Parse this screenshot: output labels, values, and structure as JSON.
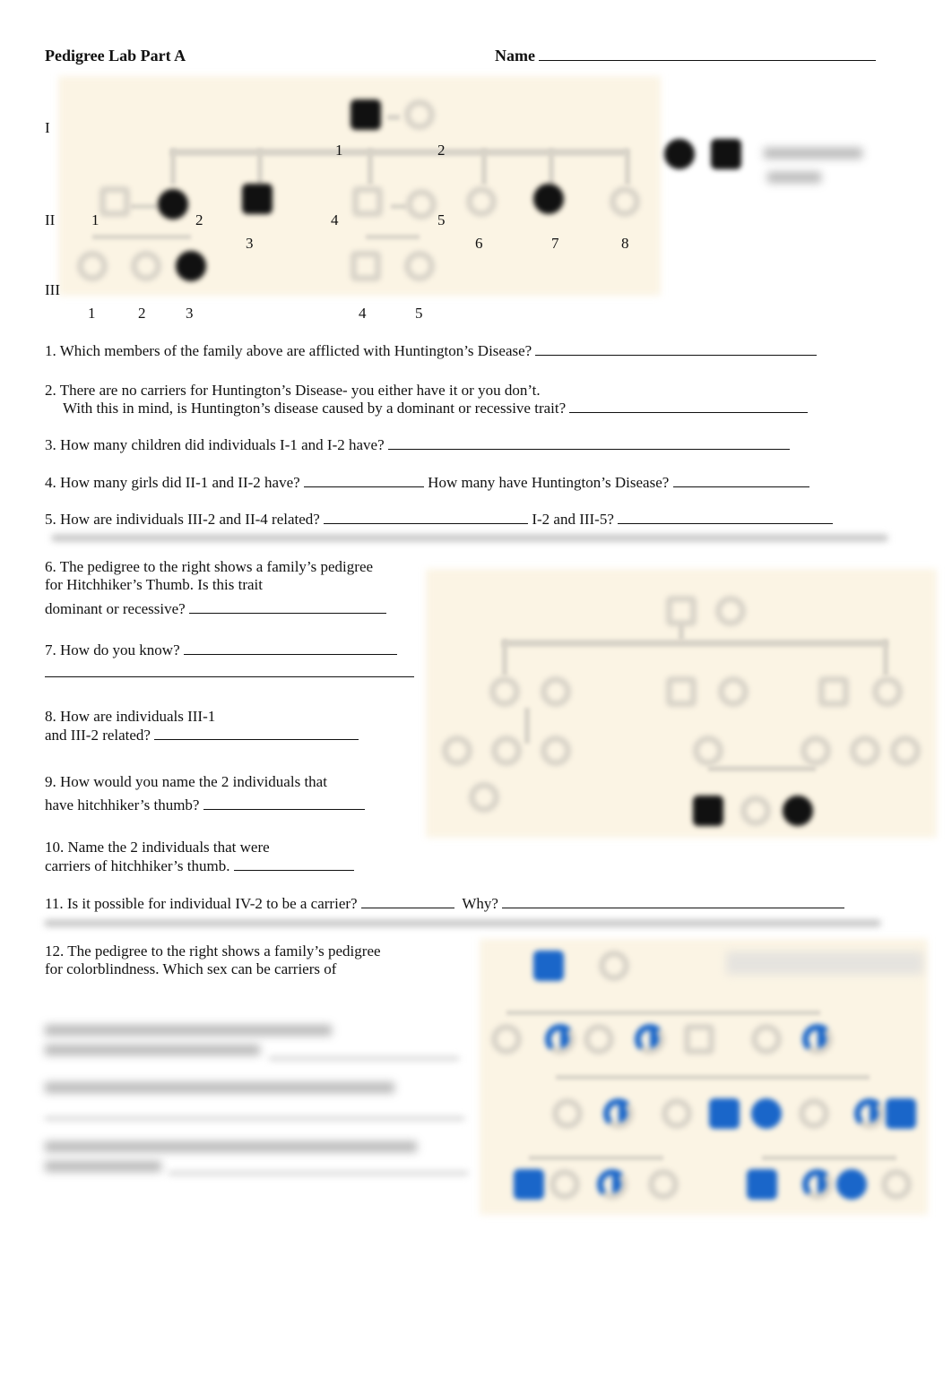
{
  "header": {
    "title": "Pedigree Lab Part A",
    "name_label": "Name"
  },
  "pedigree1": {
    "generations": [
      "I",
      "II",
      "III"
    ],
    "gen1_numbers": [
      "1",
      "2"
    ],
    "gen2_numbers": [
      "1",
      "2",
      "3",
      "4",
      "5",
      "6",
      "7",
      "8"
    ],
    "gen3_numbers": [
      "1",
      "2",
      "3",
      "4",
      "5"
    ],
    "trait_color": "#111111"
  },
  "pedigree3": {
    "trait_color": "#1a66c9"
  },
  "questions": {
    "q1": "1. Which members of the family above are afflicted with Huntington’s Disease?",
    "q2a": "2. There are no carriers for Huntington’s Disease- you either have it or you don’t.",
    "q2b": "With this in mind, is Huntington’s disease caused by a dominant or recessive trait?",
    "q3": "3. How many children did individuals I-1 and I-2 have?",
    "q4a": "4. How many girls did II-1 and II-2 have?",
    "q4b": "How many have Huntington’s Disease?",
    "q5a": "5. How are individuals III-2 and II-4 related?",
    "q5b": "I-2 and III-5?",
    "q6a": "6. The pedigree to the right shows a family’s pedigree",
    "q6b": "for Hitchhiker’s Thumb.  Is this trait",
    "q6c": "dominant or recessive?",
    "q7": "7. How do you know?",
    "q8a": "8. How are individuals III-1",
    "q8b": "and III-2 related?",
    "q9a": "9. How would you name the 2 individuals that",
    "q9b": "have hitchhiker’s thumb?",
    "q10a": "10. Name the 2 individuals that were",
    "q10b": "carriers of hitchhiker’s thumb.",
    "q11a": "11. Is it possible for individual IV-2 to be a carrier?",
    "q11b": "Why?",
    "q12a": "12. The pedigree to the right shows a family’s pedigree",
    "q12b": "for colorblindness.  Which sex can be carriers of"
  }
}
